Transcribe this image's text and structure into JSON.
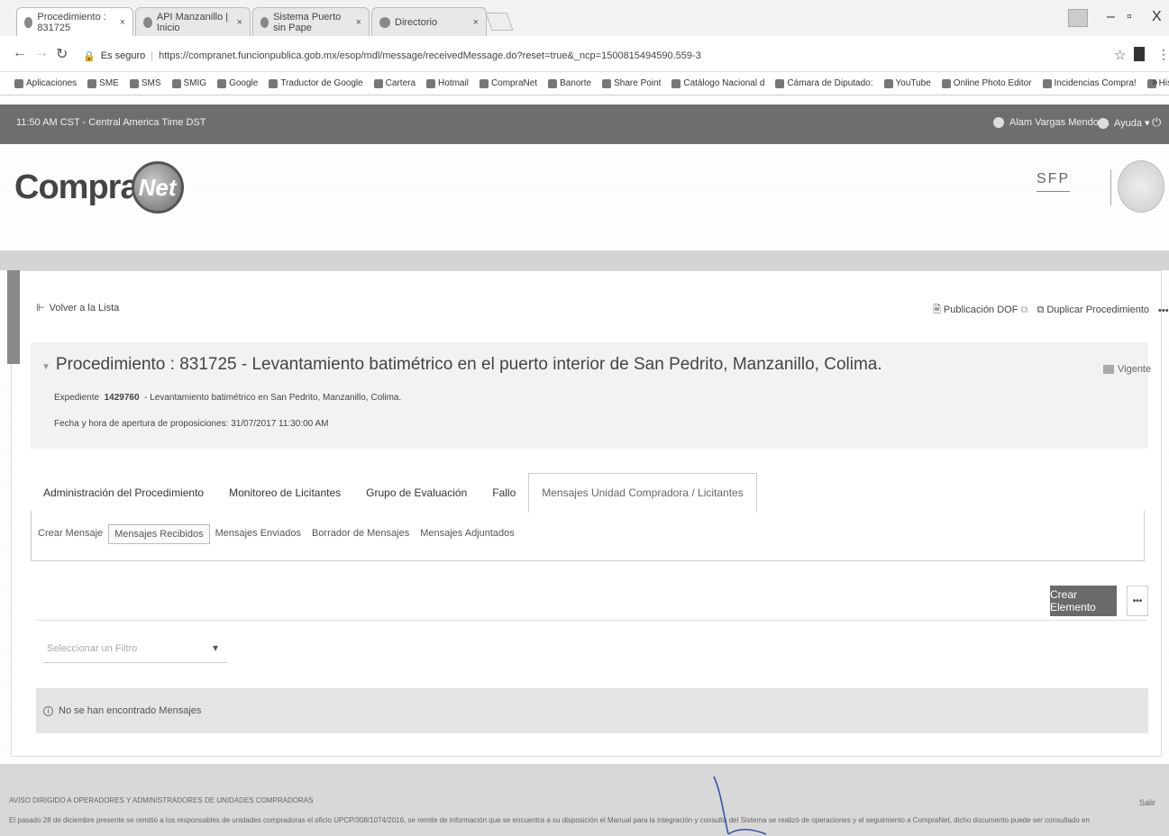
{
  "browser": {
    "tabs": [
      {
        "label": "Procedimiento : 831725",
        "active": true
      },
      {
        "label": "API Manzanillo | Inicio",
        "active": false
      },
      {
        "label": "Sistema Puerto sin Pape",
        "active": false
      },
      {
        "label": "Directorio",
        "active": false
      }
    ],
    "secure_label": "Es seguro",
    "url": "https://compranet.funcionpublica.gob.mx/esop/mdl/message/receivedMessage.do?reset=true&_ncp=1500815494590.559-3",
    "bookmarks": [
      "Aplicaciones",
      "SME",
      "SMS",
      "SMIG",
      "Google",
      "Traductor de Google",
      "Cartera",
      "Hotmail",
      "CompraNet",
      "Banorte",
      "Share Point",
      "Catálogo Nacional d",
      "Cámara de Diputado:",
      "YouTube",
      "Online Photo Editor",
      "Incidencias Compra!",
      "Historia del rey David"
    ],
    "more_bookmarks": "»"
  },
  "appbar": {
    "time": "11:50 AM CST - Central America Time DST",
    "user": "Alam Vargas Mendoza",
    "help": "Ayuda ▾"
  },
  "logo": {
    "text": "Compra",
    "globe_text": "Net"
  },
  "sfp": "SFP",
  "nav": {
    "back": "Volver a la Lista",
    "publicacion": "Publicación DOF",
    "duplicar": "Duplicar Procedimiento",
    "more": "•••"
  },
  "procedure": {
    "title": "Procedimiento : 831725 - Levantamiento batimétrico en el puerto interior de San Pedrito, Manzanillo, Colima.",
    "status": "Vigente",
    "exp_label": "Expediente",
    "exp_number": "1429760",
    "exp_desc": "- Levantamiento batimétrico en San Pedrito, Manzanillo, Colima.",
    "fecha": "Fecha y hora de apertura de proposiciones: 31/07/2017 11:30:00 AM"
  },
  "main_tabs": [
    {
      "label": "Administración del Procedimiento",
      "active": false
    },
    {
      "label": "Monitoreo de Licitantes",
      "active": false
    },
    {
      "label": "Grupo de Evaluación",
      "active": false
    },
    {
      "label": "Fallo",
      "active": false
    },
    {
      "label": "Mensajes Unidad Compradora / Licitantes",
      "active": true
    }
  ],
  "sub_tabs": [
    {
      "label": "Crear Mensaje",
      "active": false
    },
    {
      "label": "Mensajes Recibidos",
      "active": true
    },
    {
      "label": "Mensajes Enviados",
      "active": false
    },
    {
      "label": "Borrador de Mensajes",
      "active": false
    },
    {
      "label": "Mensajes Adjuntados",
      "active": false
    }
  ],
  "actions": {
    "create": "Crear Elemento",
    "more": "•••"
  },
  "filter": {
    "placeholder": "Seleccionar un Filtro"
  },
  "empty_message": "No se han encontrado Mensajes",
  "footer": {
    "notice_title": "AVISO DIRIGIDO A OPERADORES Y ADMINISTRADORES DE UNIDADES COMPRADORAS",
    "notice_text": "El pasado 28 de diciembre presente se remitió a los responsables de unidades compradoras el oficio UPCP/308/1074/2016, se remite de información que se encuentra a su disposición el Manual para la integración y consulta del Sistema se realizó de operaciones y el seguimiento a CompraNet, dicho documento puede ser consultado en la sección Manuales de Apoyo.",
    "signature": "Salir"
  }
}
